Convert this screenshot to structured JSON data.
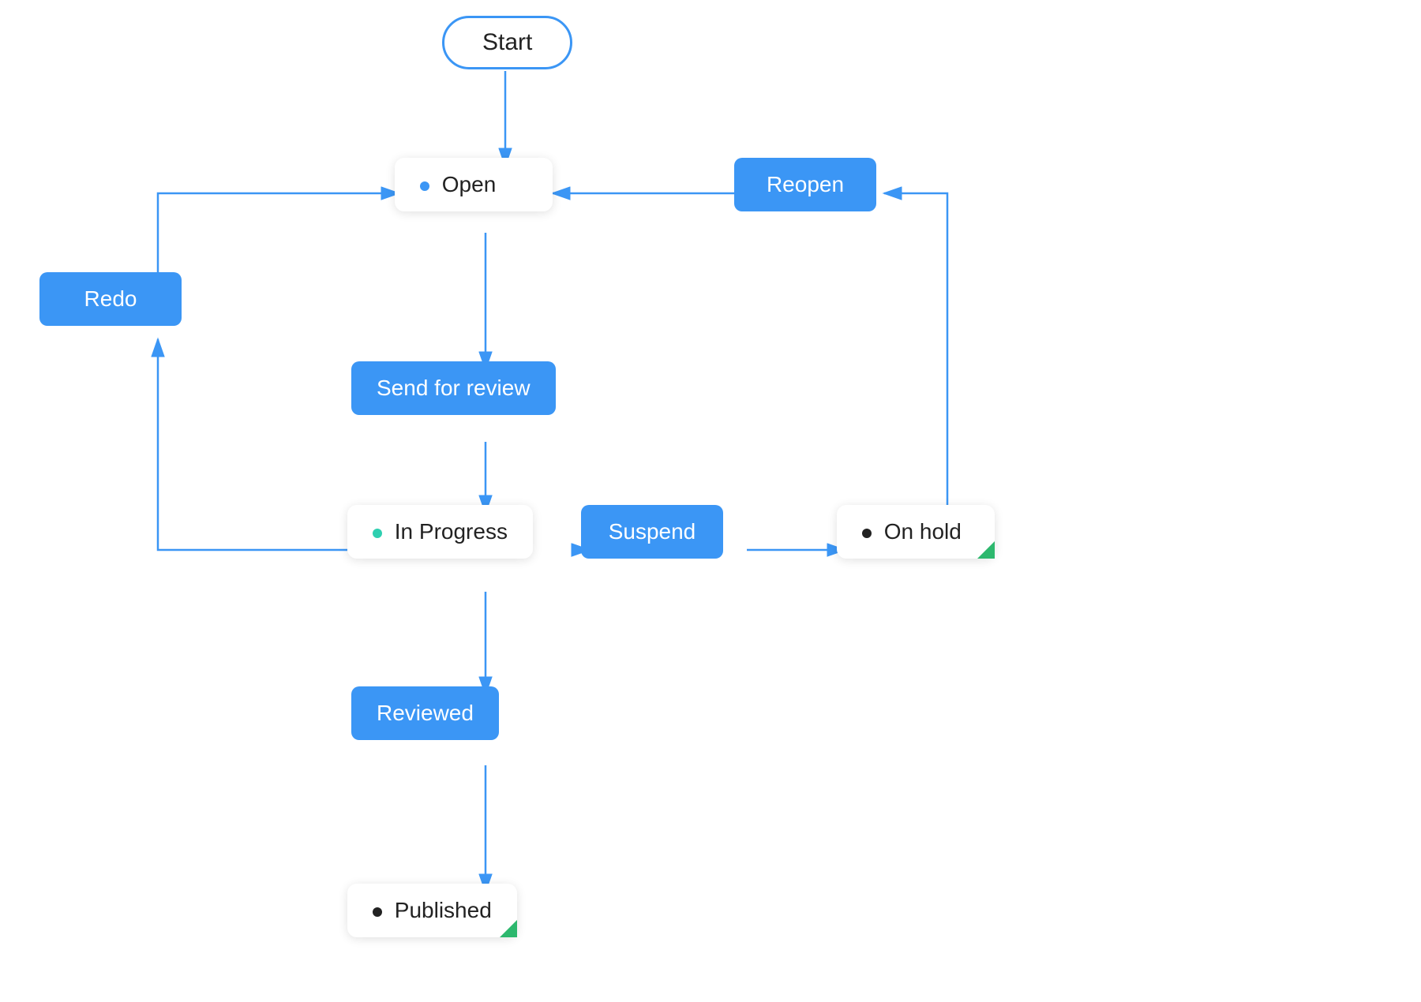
{
  "nodes": {
    "start": {
      "label": "Start"
    },
    "open": {
      "label": "Open"
    },
    "send_for_review": {
      "label": "Send for review"
    },
    "redo": {
      "label": "Redo"
    },
    "in_progress": {
      "label": "In Progress"
    },
    "suspend": {
      "label": "Suspend"
    },
    "on_hold": {
      "label": "On hold"
    },
    "reopen": {
      "label": "Reopen"
    },
    "reviewed": {
      "label": "Reviewed"
    },
    "published": {
      "label": "Published"
    }
  },
  "colors": {
    "blue": "#3b96f5",
    "teal": "#2ecfb0",
    "black": "#222222",
    "green": "#2db86e",
    "white": "#ffffff"
  }
}
